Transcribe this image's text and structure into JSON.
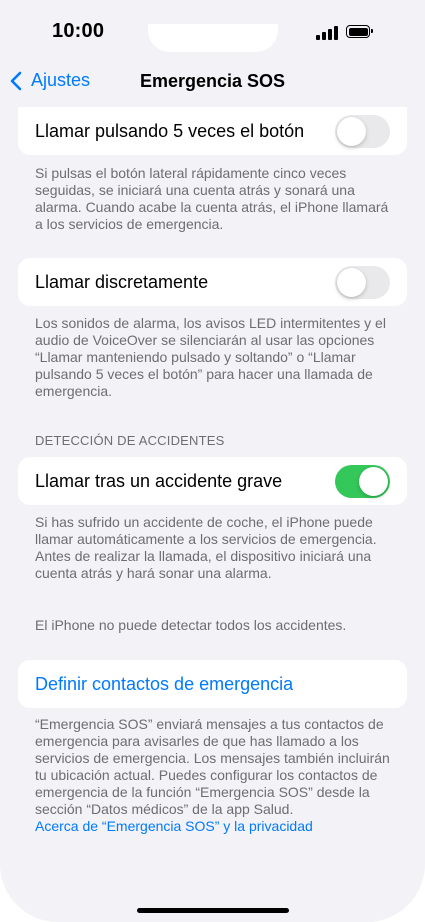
{
  "status_bar": {
    "time": "10:00",
    "signal_icon": "cellular-signal-icon",
    "battery_icon": "battery-full-icon"
  },
  "nav": {
    "back_label": "Ajustes",
    "title": "Emergencia SOS"
  },
  "settings": {
    "call_5_presses": {
      "label": "Llamar pulsando 5 veces el botón",
      "enabled": false,
      "footer": "Si pulsas el botón lateral rápidamente cinco veces seguidas, se iniciará una cuenta atrás y sonará una alarma. Cuando acabe la cuenta atrás, el iPhone llamará a los servicios de emergencia."
    },
    "call_quietly": {
      "label": "Llamar discretamente",
      "enabled": false,
      "footer": "Los sonidos de alarma, los avisos LED intermitentes y el audio de VoiceOver se silenciarán al usar las opciones “Llamar manteniendo pulsado y soltando” o “Llamar pulsando 5 veces el botón” para hacer una llamada de emergencia."
    },
    "crash_detection": {
      "header": "DETECCIÓN DE ACCIDENTES",
      "label": "Llamar tras un accidente grave",
      "enabled": true,
      "footer": "Si has sufrido un accidente de coche, el iPhone puede llamar automáticamente a los servicios de emergencia. Antes de realizar la llamada, el dispositivo iniciará una cuenta atrás y hará sonar una alarma.",
      "footer2": "El iPhone no puede detectar todos los accidentes."
    },
    "emergency_contacts": {
      "label": "Definir contactos de emergencia",
      "footer": "“Emergencia SOS” enviará mensajes a tus contactos de emergencia para avisarles de que has llamado a los servicios de emergencia. Los mensajes también incluirán tu ubicación actual. Puedes configurar los contactos de emergencia de la función “Emergencia SOS” desde la sección “Datos médicos” de la app Salud.",
      "privacy_link": "Acerca de “Emergencia SOS” y la privacidad"
    }
  },
  "colors": {
    "accent": "#007aff",
    "toggle_on": "#34c759",
    "toggle_off": "#e9e9eb",
    "background": "#f2f2f7",
    "footer_text": "#6d6d72"
  }
}
